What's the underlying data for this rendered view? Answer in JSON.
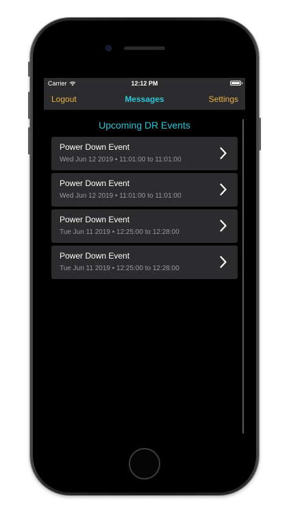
{
  "status_bar": {
    "carrier": "Carrier",
    "time": "12:12 PM",
    "wifi_icon": "wifi-icon",
    "battery_icon": "battery-icon"
  },
  "nav": {
    "left_label": "Logout",
    "title": "Messages",
    "right_label": "Settings"
  },
  "section": {
    "title": "Upcoming DR Events"
  },
  "events": [
    {
      "title": "Power Down Event",
      "subtitle": "Wed Jun 12 2019 • 11:01:00 to 11:01:00"
    },
    {
      "title": "Power Down Event",
      "subtitle": "Wed Jun 12 2019 • 11:01:00 to 11:01:00"
    },
    {
      "title": "Power Down Event",
      "subtitle": "Tue Jun 11 2019 • 12:25:00 to 12:28:00"
    },
    {
      "title": "Power Down Event",
      "subtitle": "Tue Jun 11 2019 • 12:25:00 to 12:28:00"
    }
  ],
  "colors": {
    "accent_cyan": "#2ec4d6",
    "accent_orange": "#e8b04a",
    "bar_background": "#2c2c2e",
    "row_background": "#2c2c2e",
    "screen_background": "#000000"
  }
}
